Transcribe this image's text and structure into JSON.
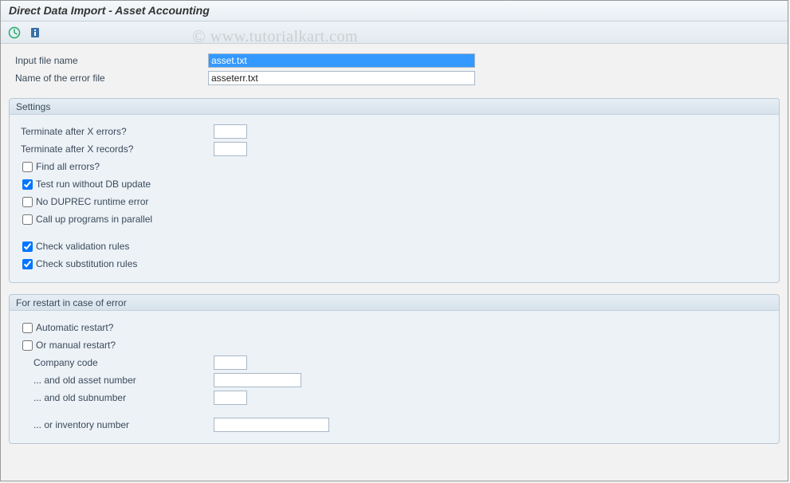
{
  "title": "Direct Data Import - Asset Accounting",
  "watermark": "© www.tutorialkart.com",
  "files": {
    "input_label": "Input file name",
    "input_value": "asset.txt",
    "error_label": "Name of the error file",
    "error_value": "asseterr.txt"
  },
  "settings": {
    "header": "Settings",
    "term_errors_label": "Terminate after X errors?",
    "term_errors_value": "",
    "term_records_label": "Terminate after X records?",
    "term_records_value": "",
    "find_all_label": "Find all errors?",
    "find_all_checked": false,
    "test_run_label": "Test run without DB update",
    "test_run_checked": true,
    "no_duprec_label": "No DUPREC runtime error",
    "no_duprec_checked": false,
    "parallel_label": "Call up programs in parallel",
    "parallel_checked": false,
    "check_val_label": "Check validation rules",
    "check_val_checked": true,
    "check_sub_label": "Check substitution rules",
    "check_sub_checked": true
  },
  "restart": {
    "header": "For restart in case of error",
    "auto_label": "Automatic restart?",
    "auto_checked": false,
    "manual_label": "Or manual restart?",
    "manual_checked": false,
    "company_label": "Company code",
    "company_value": "",
    "old_asset_label": "... and old asset number",
    "old_asset_value": "",
    "old_sub_label": "... and old subnumber",
    "old_sub_value": "",
    "inventory_label": "... or inventory number",
    "inventory_value": ""
  }
}
